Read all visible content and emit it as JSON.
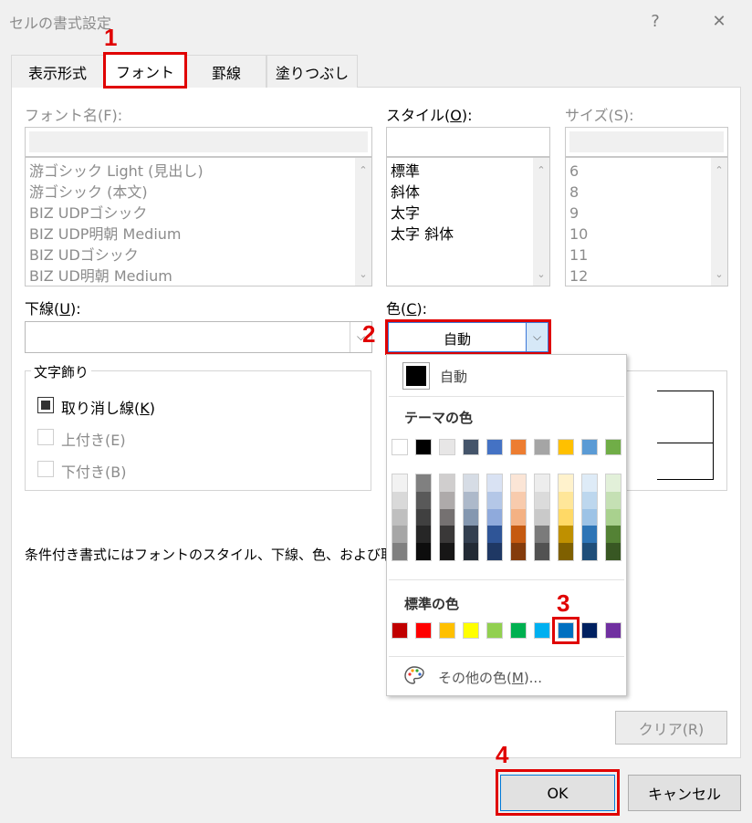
{
  "window": {
    "title": "セルの書式設定",
    "help_glyph": "?",
    "close_glyph": "✕"
  },
  "tabs": [
    {
      "label": "表示形式"
    },
    {
      "label": "フォント"
    },
    {
      "label": "罫線"
    },
    {
      "label": "塗りつぶし"
    }
  ],
  "annotations": [
    "1",
    "2",
    "3",
    "4"
  ],
  "font_name": {
    "label": "フォント名(F):",
    "value": "",
    "items": [
      "游ゴシック Light (見出し)",
      "游ゴシック (本文)",
      "BIZ UDPゴシック",
      "BIZ UDP明朝 Medium",
      "BIZ UDゴシック",
      "BIZ UD明朝 Medium"
    ]
  },
  "style": {
    "label_pre": "スタイル(",
    "label_key": "O",
    "label_post": "):",
    "value": "",
    "items": [
      "標準",
      "斜体",
      "太字",
      "太字 斜体"
    ]
  },
  "size": {
    "label": "サイズ(S):",
    "value": "",
    "items": [
      "6",
      "8",
      "9",
      "10",
      "11",
      "12"
    ]
  },
  "underline": {
    "label_pre": "下線(",
    "label_key": "U",
    "label_post": "):",
    "value": ""
  },
  "color": {
    "label_pre": "色(",
    "label_key": "C",
    "label_post": "):",
    "value": "自動"
  },
  "effects": {
    "group_label": "文字飾り",
    "strikethrough": {
      "label_pre": "取り消し線(",
      "label_key": "K",
      "label_post": ")",
      "checked": true
    },
    "superscript": {
      "label": "上付き(E)",
      "checked": false
    },
    "subscript": {
      "label": "下付き(B)",
      "checked": false
    }
  },
  "info_text": "条件付き書式にはフォントのスタイル、下線、色、および取",
  "clear_button": "クリア(R)",
  "ok_button": "OK",
  "cancel_button": "キャンセル",
  "color_dropdown": {
    "auto_label": "自動",
    "auto_color": "#000000",
    "theme_heading": "テーマの色",
    "theme_colors": [
      "#ffffff",
      "#000000",
      "#e7e6e6",
      "#44546a",
      "#4472c4",
      "#ed7d31",
      "#a5a5a5",
      "#ffc000",
      "#5b9bd5",
      "#70ad47"
    ],
    "theme_shades": [
      [
        "#f2f2f2",
        "#d9d9d9",
        "#bfbfbf",
        "#a6a6a6",
        "#808080"
      ],
      [
        "#808080",
        "#595959",
        "#404040",
        "#262626",
        "#0d0d0d"
      ],
      [
        "#d0cece",
        "#aeaaaa",
        "#757171",
        "#3a3838",
        "#171616"
      ],
      [
        "#d6dce5",
        "#adb9ca",
        "#8497b0",
        "#333f50",
        "#222a35"
      ],
      [
        "#d9e2f3",
        "#b4c7e7",
        "#8faadc",
        "#2f5597",
        "#1f3864"
      ],
      [
        "#fbe5d6",
        "#f8cbad",
        "#f4b183",
        "#c55a11",
        "#843c0c"
      ],
      [
        "#ededed",
        "#dbdbdb",
        "#c9c9c9",
        "#7b7b7b",
        "#525252"
      ],
      [
        "#fff2cc",
        "#ffe699",
        "#ffd966",
        "#bf9000",
        "#7f6000"
      ],
      [
        "#deebf7",
        "#bdd7ee",
        "#9dc3e6",
        "#2e75b6",
        "#1f4e79"
      ],
      [
        "#e2f0d9",
        "#c5e0b4",
        "#a9d18e",
        "#548235",
        "#385723"
      ]
    ],
    "standard_heading": "標準の色",
    "standard_colors": [
      "#c00000",
      "#ff0000",
      "#ffc000",
      "#ffff00",
      "#92d050",
      "#00b050",
      "#00b0f0",
      "#0070c0",
      "#002060",
      "#7030a0"
    ],
    "more_colors_pre": "その他の色(",
    "more_colors_key": "M",
    "more_colors_post": ")..."
  }
}
